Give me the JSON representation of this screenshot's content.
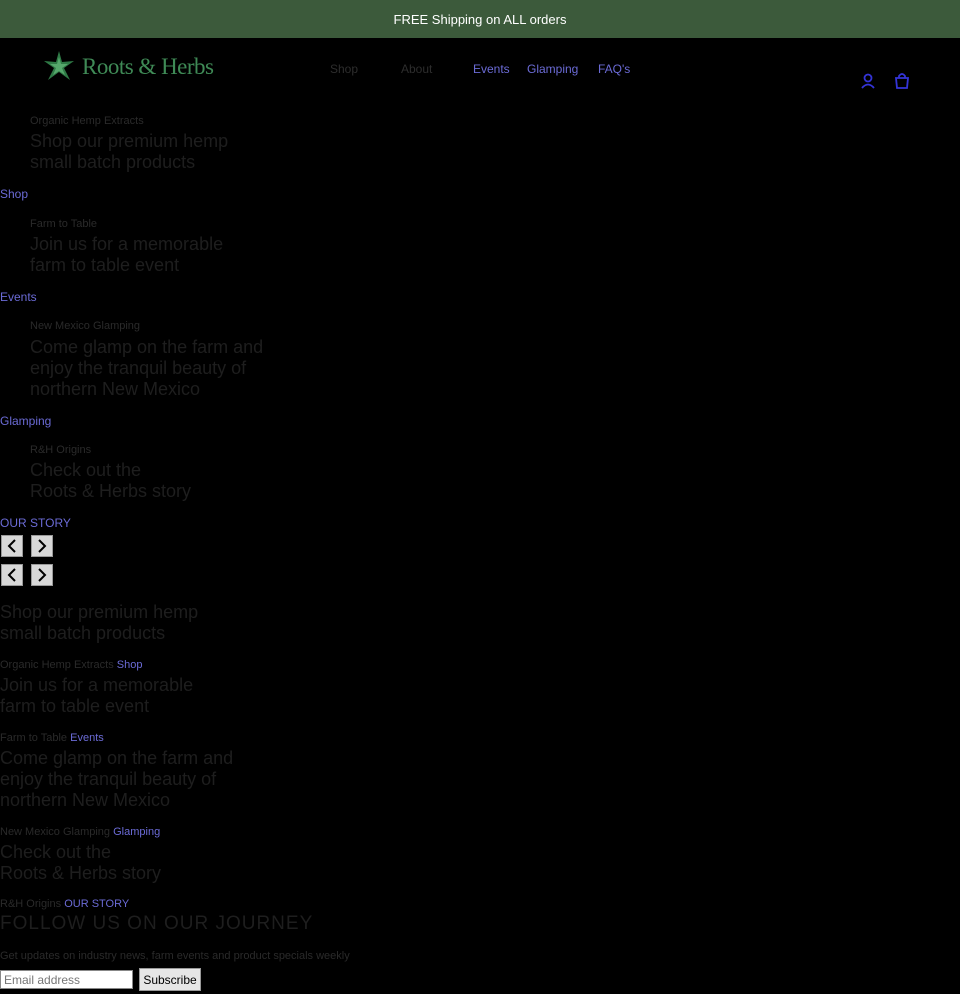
{
  "announcement": "FREE Shipping on ALL orders",
  "logo": {
    "text": "Roots & Herbs",
    "color": "#3f8a56"
  },
  "nav": {
    "items": [
      {
        "label": "Shop"
      },
      {
        "label": "About"
      },
      {
        "label": "Events"
      },
      {
        "label": "Glamping"
      },
      {
        "label": "FAQ's"
      }
    ]
  },
  "header_icons": {
    "account": "account-icon",
    "cart": "cart-icon"
  },
  "slides": [
    {
      "subtitle": "Organic Hemp Extracts",
      "heading": "Shop our premium hemp\nsmall batch products",
      "link": "Shop"
    },
    {
      "subtitle": "Farm to Table",
      "heading": "Join us for a memorable\nfarm to table event",
      "link": "Events"
    },
    {
      "subtitle": "New Mexico Glamping",
      "heading": "Come glamp on the farm and\nenjoy the tranquil beauty of\nnorthern New Mexico",
      "link": "Glamping"
    },
    {
      "subtitle": "R&H Origins",
      "heading": "Check out the\nRoots & Herbs story",
      "link": "OUR STORY"
    }
  ],
  "footer": {
    "follow_title": "FOLLOW US ON OUR JOURNEY",
    "updates_text": "Get updates on industry news, farm events and product specials weekly",
    "email_placeholder": "Email address",
    "subscribe_label": "Subscribe"
  },
  "colors": {
    "announcement_bg": "#3c5a3b",
    "link": "#6b6bd6",
    "background": "#000000"
  }
}
